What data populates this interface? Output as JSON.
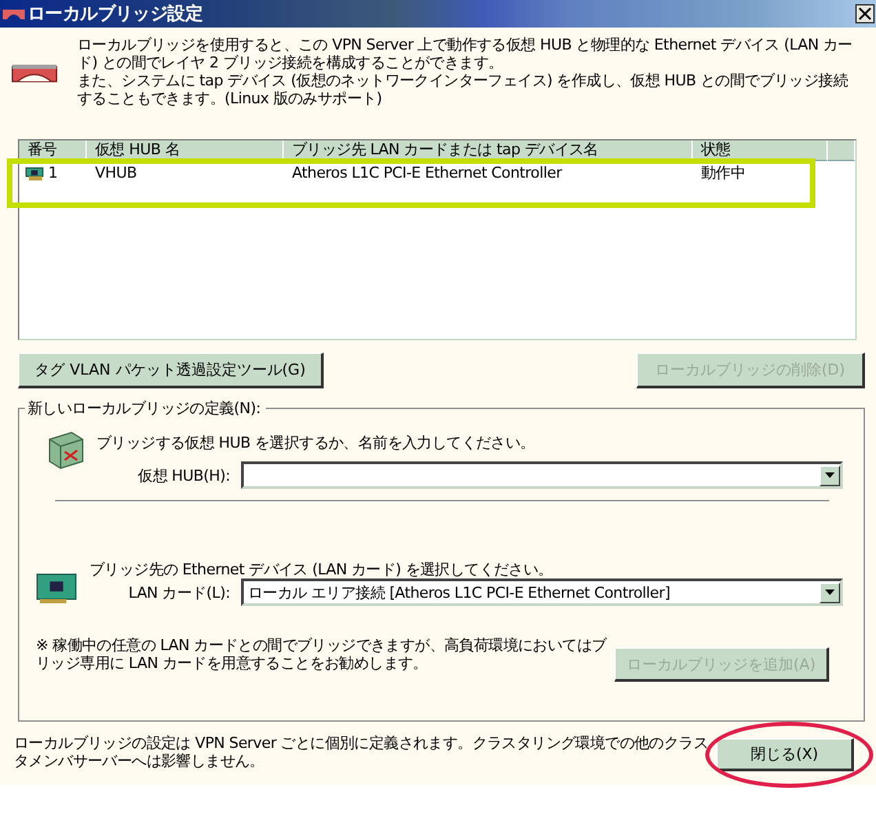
{
  "window": {
    "title": "ローカルブリッジ設定"
  },
  "intro": [
    "ローカルブリッジを使用すると、この VPN Server 上で動作する仮想 HUB と物理的な Ethernet デバイス (LAN カード) との間でレイヤ 2 ブリッジ接続を構成することができます。",
    "また、システムに tap デバイス (仮想のネットワークインターフェイス) を作成し、仮想 HUB との間でブリッジ接続することもできます。(Linux 版のみサポート)"
  ],
  "bridge_table": {
    "columns": [
      "番号",
      "仮想 HUB 名",
      "ブリッジ先 LAN カードまたは tap デバイス名",
      "状態"
    ],
    "rows": [
      {
        "number": "1",
        "hub": "VHUB",
        "device": "Atheros L1C PCI-E Ethernet Controller",
        "status": "動作中"
      }
    ]
  },
  "buttons": [
    {
      "label": "タグ VLAN パケット透過設定ツール(G)",
      "disabled": false
    },
    {
      "label": "ローカルブリッジの削除(D)",
      "disabled": true
    }
  ],
  "new_bridge": {
    "title": "新しいローカルブリッジの定義(N):",
    "hub_prompt": "ブリッジする仮想 HUB を選択するか、名前を入力してください。",
    "hub_field": {
      "label": "仮想 HUB(H):"
    },
    "lan_prompt": "ブリッジ先の Ethernet デバイス (LAN カード) を選択してください。",
    "lan_field": {
      "label": "LAN カード(L):",
      "value": "ローカル エリア接続 [Atheros L1C PCI-E Ethernet Controller]"
    },
    "note": "※ 稼働中の任意の LAN カードとの間でブリッジできますが、高負荷環境においてはブリッジ専用に LAN カードを用意することをお勧めします。",
    "add_button": {
      "label": "ローカルブリッジを追加(A)",
      "disabled": true
    }
  },
  "footer": {
    "note": "ローカルブリッジの設定は VPN Server ごとに個別に定義されます。クラスタリング環境での他のクラスタメンバサーバーへは影響しません。",
    "close_button": {
      "label": "閉じる(X)",
      "disabled": false
    }
  },
  "annotations": [
    {
      "kind": "rectangle",
      "color": "#c4de00"
    },
    {
      "kind": "ellipse",
      "color": "#e0204a"
    }
  ]
}
